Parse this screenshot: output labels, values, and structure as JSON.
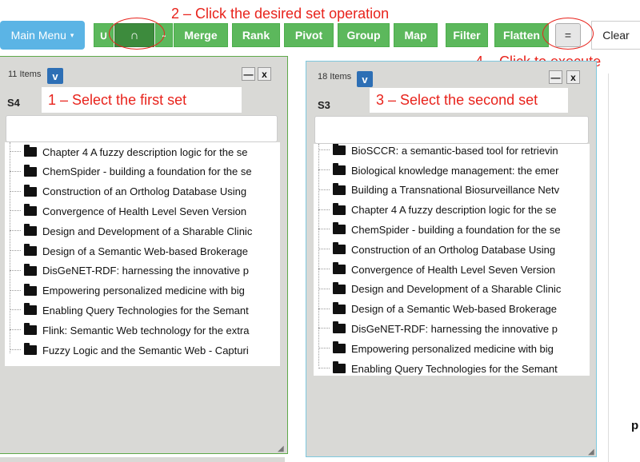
{
  "toolbar": {
    "main_menu_label": "Main Menu",
    "main_menu_caret": "▾",
    "union_label": "∪",
    "intersect_label": "∩",
    "minus_label": "-",
    "merge_label": "Merge",
    "rank_label": "Rank",
    "pivot_label": "Pivot",
    "group_label": "Group",
    "map_label": "Map",
    "filter_label": "Filter",
    "flatten_label": "Flatten",
    "execute_label": "=",
    "clear_label": "Clear"
  },
  "annotations": {
    "step2": "2 – Click the desired set operation",
    "step1": "1 – Select the first set",
    "step3": "3 – Select the second set",
    "step4": "4 – Click to execute"
  },
  "left_panel": {
    "count": "11 Items",
    "v_label": "v",
    "minimize_label": "—",
    "close_label": "x",
    "set_name": "S4",
    "search_value": "",
    "items": [
      "Chapter 4 A fuzzy description logic for the se",
      "ChemSpider - building a foundation for the se",
      "Construction of an Ortholog Database Using",
      "Convergence of Health Level Seven Version",
      "Design and Development of a Sharable Clinic",
      "Design of a Semantic Web-based Brokerage",
      "DisGeNET-RDF: harnessing the innovative p",
      "Empowering personalized medicine with big",
      "Enabling Query Technologies for the Semant",
      "Flink: Semantic Web technology for the extra",
      "Fuzzy Logic and the Semantic Web - Capturi"
    ]
  },
  "right_panel": {
    "count": "18 Items",
    "v_label": "v",
    "minimize_label": "—",
    "close_label": "x",
    "set_name": "S3",
    "search_value": "",
    "partial_top_item": "BioSCCR: a semantic-based tool for retrievin",
    "items": [
      "Biological knowledge management: the emer",
      "Building a Transnational Biosurveillance Netv",
      "Chapter 4 A fuzzy description logic for the se",
      "ChemSpider - building a foundation for the se",
      "Construction of an Ortholog Database Using",
      "Convergence of Health Level Seven Version",
      "Design and Development of a Sharable Clinic",
      "Design of a Semantic Web-based Brokerage",
      "DisGeNET-RDF: harnessing the innovative p",
      "Empowering personalized medicine with big",
      "Enabling Query Technologies for the Semant"
    ]
  },
  "edge_fragment": "p",
  "colors": {
    "op_button": "#5cb85c",
    "op_button_active": "#3d8b3d",
    "main_menu": "#5bb4e5",
    "annotation": "#e8231c",
    "left_panel_border": "#5fa94a",
    "right_panel_border": "#7ec8de",
    "v_button": "#2d6fb5"
  }
}
